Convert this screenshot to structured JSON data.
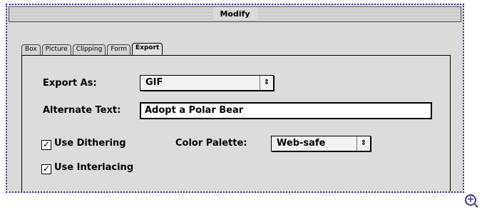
{
  "dialog": {
    "title": "Modify"
  },
  "tabs": [
    "Box",
    "Picture",
    "Clipping",
    "Form",
    "Export"
  ],
  "active_tab": "Export",
  "export_as": {
    "label": "Export As:",
    "value": "GIF"
  },
  "alternate_text": {
    "label": "Alternate Text:",
    "value": "Adopt a Polar Bear"
  },
  "use_dithering": {
    "label": "Use Dithering",
    "checked": true
  },
  "color_palette": {
    "label": "Color Palette:",
    "value": "Web-safe"
  },
  "use_interlacing": {
    "label": "Use Interlacing",
    "checked": true
  },
  "popup_arrow": "⇕",
  "check_mark": "✓",
  "zoom_glyph": "+"
}
